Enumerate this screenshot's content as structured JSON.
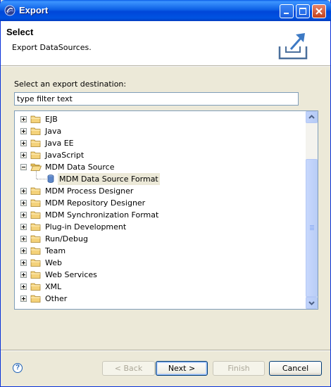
{
  "window": {
    "title": "Export"
  },
  "header": {
    "title": "Select",
    "description": "Export DataSources."
  },
  "filter": {
    "label": "Select an export destination:",
    "value": "type filter text"
  },
  "tree": {
    "items": [
      {
        "label": "EJB",
        "expanded": false
      },
      {
        "label": "Java",
        "expanded": false
      },
      {
        "label": "Java EE",
        "expanded": false
      },
      {
        "label": "JavaScript",
        "expanded": false
      },
      {
        "label": "MDM Data Source",
        "expanded": true
      },
      {
        "label": "MDM Data Source Format",
        "child": true,
        "selected": true
      },
      {
        "label": "MDM Process Designer",
        "expanded": false
      },
      {
        "label": "MDM Repository Designer",
        "expanded": false
      },
      {
        "label": "MDM Synchronization Format",
        "expanded": false
      },
      {
        "label": "Plug-in Development",
        "expanded": false
      },
      {
        "label": "Run/Debug",
        "expanded": false
      },
      {
        "label": "Team",
        "expanded": false
      },
      {
        "label": "Web",
        "expanded": false
      },
      {
        "label": "Web Services",
        "expanded": false
      },
      {
        "label": "XML",
        "expanded": false
      },
      {
        "label": "Other",
        "expanded": false
      }
    ]
  },
  "buttons": {
    "back": "< Back",
    "next": "Next >",
    "finish": "Finish",
    "cancel": "Cancel",
    "help": "?"
  },
  "colors": {
    "titlebar": "#0054e3",
    "folder": "#f4d27a",
    "selection": "#ece9d8"
  }
}
